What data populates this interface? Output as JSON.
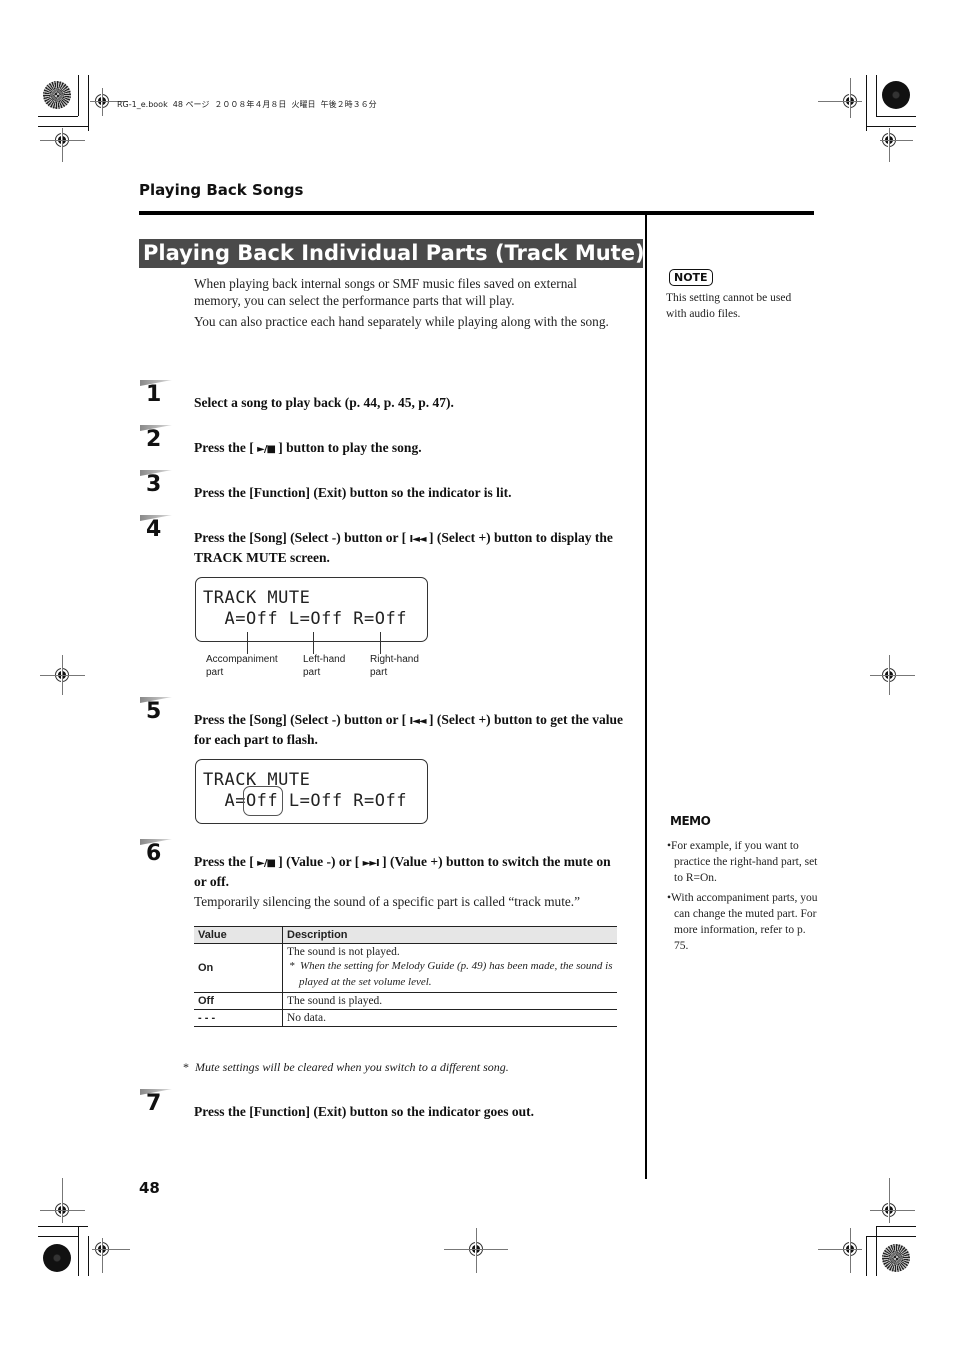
{
  "print_header": "RG-1_e.book  48 ページ  ２００８年４月８日  火曜日  午後２時３６分",
  "section_heading": "Playing Back Songs",
  "title": "Playing Back Individual Parts (Track Mute)",
  "intro": [
    "When playing back internal songs or SMF music files saved on external memory, you can select the performance parts that will play.",
    "You can also practice each hand separately while playing along with the song."
  ],
  "steps": [
    {
      "num": "1",
      "text": "Select a song to play back (p. 44, p. 45, p. 47)."
    },
    {
      "num": "2",
      "pre": "Press the [ ",
      "icon": "play-stop",
      "post": " ] button to play the song."
    },
    {
      "num": "3",
      "text": "Press the [Function] (Exit) button so the indicator is lit."
    },
    {
      "num": "4",
      "pre": "Press the [Song] (Select -) button or [ ",
      "icon": "rewind",
      "post": " ] (Select +) button to display the TRACK MUTE screen."
    },
    {
      "num": "5",
      "pre": "Press the [Song] (Select -) button or [ ",
      "icon": "rewind",
      "post": " ] (Select +) button to get the value for each part to flash."
    },
    {
      "num": "6",
      "pre": "Press the [ ",
      "icon": "play-stop",
      "mid": " ] (Value -) or [ ",
      "icon2": "fast-forward",
      "post": " ] (Value +) button to switch the mute on or off.",
      "sub": "Temporarily silencing the sound of a specific part is called “track mute.”"
    },
    {
      "num": "7",
      "text": "Press the [Function] (Exit) button so the indicator goes out."
    }
  ],
  "icons": {
    "play_stop": "►/■",
    "rewind": "I◄◄",
    "fast_forward": "►►I"
  },
  "lcd1": {
    "line1": "TRACK MUTE",
    "line2": "  A=Off L=Off R=Off",
    "labels": [
      {
        "line1": "Accompaniment",
        "line2": "part"
      },
      {
        "line1": "Left-hand",
        "line2": "part"
      },
      {
        "line1": "Right-hand",
        "line2": "part"
      }
    ]
  },
  "lcd2": {
    "line1": "TRACK MUTE",
    "line2": "  A=Off L=Off R=Off",
    "flashing": "A"
  },
  "table": {
    "headers": [
      "Value",
      "Description"
    ],
    "rows": [
      {
        "value": "On",
        "desc": "The sound is not played.",
        "note": "When the setting for Melody Guide (p. 49) has been made, the sound is played at the set volume level."
      },
      {
        "value": "Off",
        "desc": "The sound is played."
      },
      {
        "value": "- - -",
        "desc": "No data."
      }
    ]
  },
  "footnote": "Mute settings will be cleared when you switch to a different song.",
  "asterisk": "*",
  "note": {
    "label": "NOTE",
    "text": "This setting cannot be used with audio files."
  },
  "memo": {
    "label": "MEMO",
    "bullets": [
      "For example, if you want to practice the right-hand part, set to R=On.",
      "With accompaniment parts, you can change the muted part. For more information, refer to p. 75."
    ]
  },
  "page_number": "48"
}
